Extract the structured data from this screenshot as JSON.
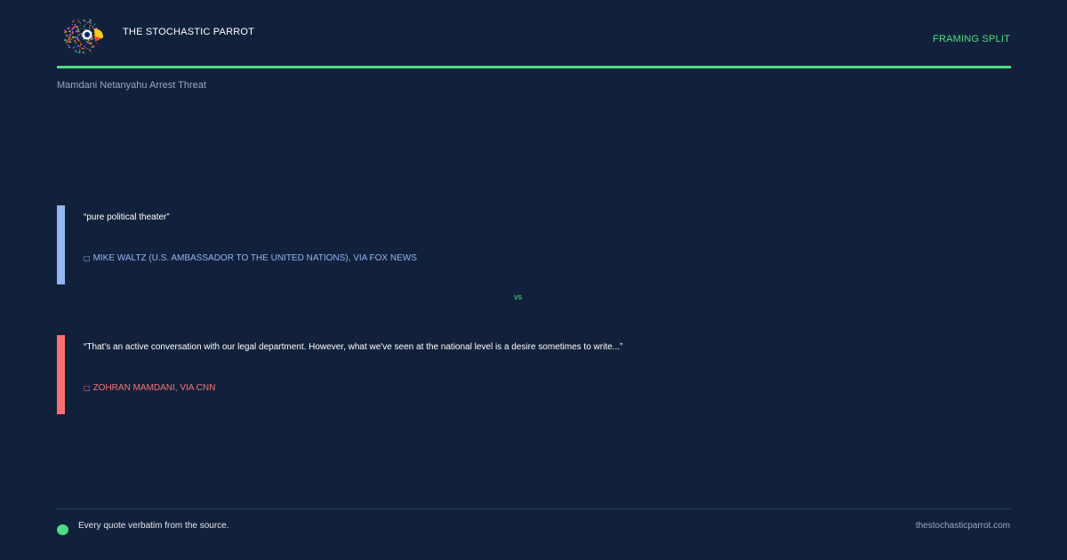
{
  "header": {
    "brand_name": "THE STOCHASTIC PARROT",
    "section_tag": "FRAMING SPLIT",
    "topic": "Mamdani Netanyahu Arrest Threat"
  },
  "colors": {
    "background": "#12213b",
    "accent": "#4ade80",
    "side_a": "#93b4f5",
    "side_b": "#f87171"
  },
  "quotes": [
    {
      "text": "“pure political theater”",
      "attribution": "MIKE WALTZ (U.S. AMBASSADOR TO THE UNITED NATIONS), VIA FOX NEWS"
    },
    {
      "text": "“That's an active conversation with our legal department. However, what we've seen at the national level is a desire sometimes to write...”",
      "attribution": "ZOHRAN MAMDANI, VIA CNN"
    }
  ],
  "vs_label": "vs",
  "footer": {
    "note": "Every quote verbatim from the source.",
    "site": "thestochasticparrot.com"
  }
}
